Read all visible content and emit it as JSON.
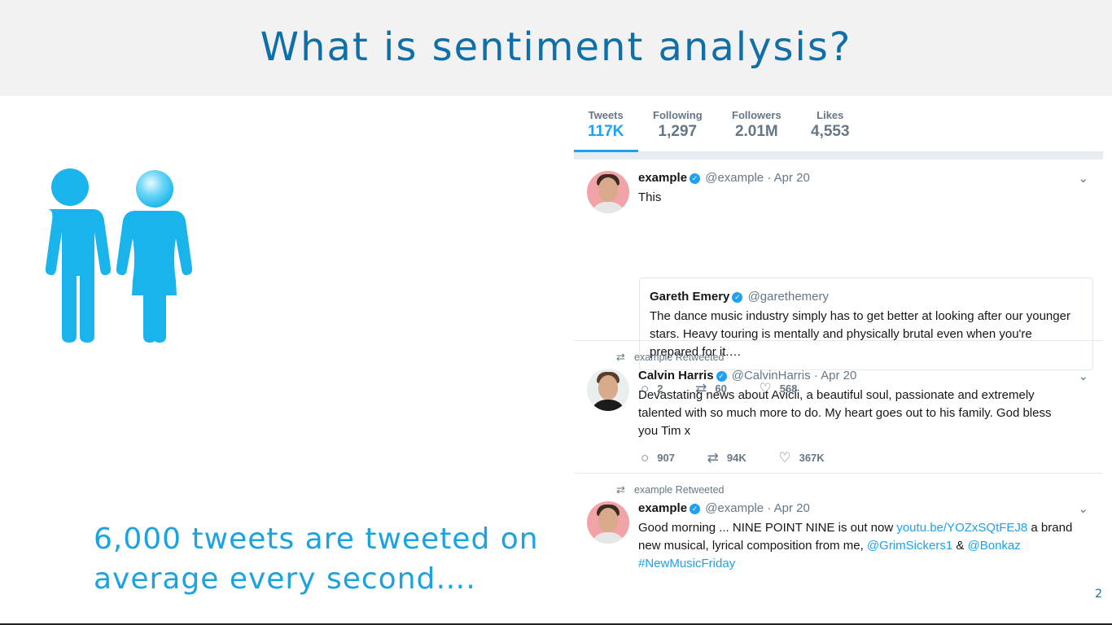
{
  "slide": {
    "title": "What is sentiment analysis?",
    "caption_line1": "6,000 tweets are tweeted on",
    "caption_line2": "average every second….",
    "page_number": "2"
  },
  "colors": {
    "title": "#0f6fa8",
    "caption": "#1aa3e0",
    "people_icon": "#1ab4ec",
    "twitter_blue": "#1da1f2",
    "header_bg": "#f2f2f2"
  },
  "profile_stats": [
    {
      "label": "Tweets",
      "value": "117K",
      "active": true
    },
    {
      "label": "Following",
      "value": "1,297"
    },
    {
      "label": "Followers",
      "value": "2.01M"
    },
    {
      "label": "Likes",
      "value": "4,553"
    }
  ],
  "tweets": [
    {
      "name": "example",
      "handle": "@example",
      "date": "· Apr 20",
      "text": "This",
      "quoted": {
        "name": "Gareth Emery",
        "handle": "@garethemery",
        "text": "The dance music industry simply has to get better at looking after our younger stars. Heavy touring is mentally and physically brutal even when you're prepared for it.…"
      },
      "replies": "2",
      "retweets": "60",
      "likes": "568"
    },
    {
      "retweeted_by": "example Retweeted",
      "name": "Calvin Harris",
      "handle": "@CalvinHarris",
      "date": "· Apr 20",
      "text": "Devastating news about Avicii, a beautiful soul, passionate and extremely talented with so much more to do. My heart goes out to his family. God bless you Tim x",
      "replies": "907",
      "retweets": "94K",
      "likes": "367K"
    },
    {
      "retweeted_by": "example Retweeted",
      "name": "example",
      "handle": "@example",
      "date": "· Apr 20",
      "text_before": "Good morning ... NINE POINT NINE is out now ",
      "link1": "youtu.be/YOZxSQtFEJ8",
      "text_middle": " a brand new musical, lyrical composition from me, ",
      "mention1": "@GrimSickers1",
      "amp": " & ",
      "mention2": "@Bonkaz",
      "hashtag": "#NewMusicFriday"
    }
  ],
  "icons": {
    "verified": "verified-check-icon",
    "reply": "reply-icon",
    "retweet": "retweet-icon",
    "like": "heart-icon",
    "chevron": "chevron-down-icon",
    "people": "man-woman-icon"
  }
}
